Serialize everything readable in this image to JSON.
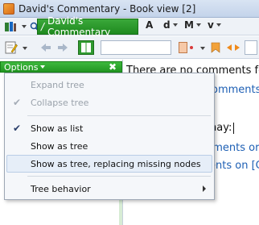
{
  "window": {
    "title": "David's Commentary - Book view [2]"
  },
  "toolbar": {
    "active_tab": "David's Commentary",
    "tab_prefix": "/",
    "font_button": "A",
    "d_button": "d",
    "m_button": "M",
    "v_button": "v"
  },
  "panel": {
    "options_label": "Options",
    "close_label": "✖"
  },
  "menu": {
    "items": [
      {
        "label": "Expand tree",
        "enabled": false,
        "checked": false
      },
      {
        "label": "Collapse tree",
        "enabled": false,
        "checked": true
      },
      {
        "label": "Show as list",
        "enabled": true,
        "checked": true
      },
      {
        "label": "Show as tree",
        "enabled": true,
        "checked": false
      },
      {
        "label": "Show as tree, replacing missing nodes",
        "enabled": true,
        "checked": false,
        "highlighted": true
      },
      {
        "label": "Tree behavior",
        "enabled": true,
        "checked": false,
        "submenu": true
      }
    ],
    "check_glyph": "✔"
  },
  "content": {
    "no_comments": "There are no comments for",
    "line2": "omments",
    "line3": "nay:",
    "line4": "nments or",
    "line5": "ents on [C"
  }
}
